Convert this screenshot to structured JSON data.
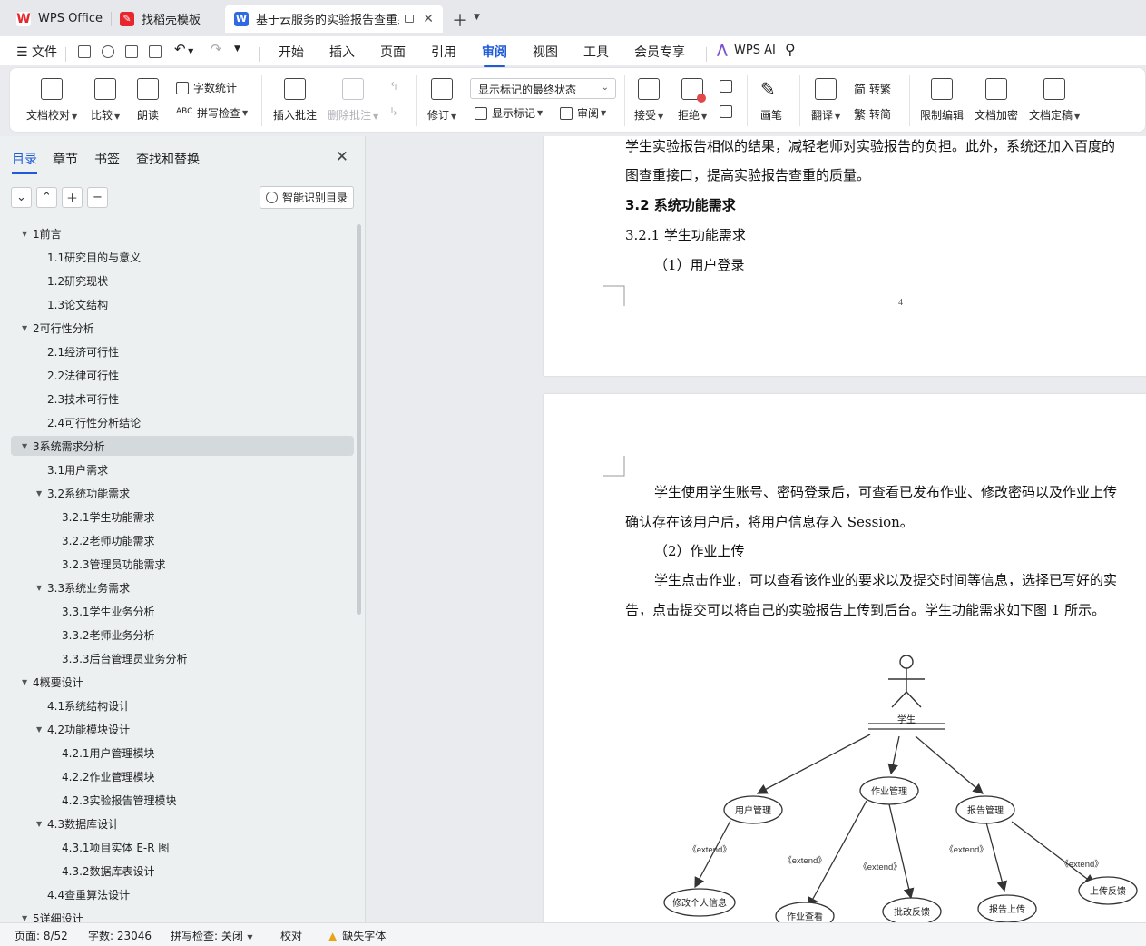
{
  "tabs": [
    {
      "label": "WPS Office",
      "icon": "wps-logo-icon"
    },
    {
      "label": "找稻壳模板",
      "icon": "docer-icon"
    },
    {
      "label": "基于云服务的实验报告查重系统",
      "icon": "writer-icon",
      "active": true
    }
  ],
  "menu": {
    "file": "文件",
    "items": [
      "开始",
      "插入",
      "页面",
      "引用",
      "审阅",
      "视图",
      "工具",
      "会员专享"
    ],
    "active": "审阅",
    "ai": "WPS AI"
  },
  "ribbon": {
    "doc_proof": "文档校对",
    "compare": "比较",
    "read_aloud": "朗读",
    "word_count": "字数统计",
    "spell_check": "拼写检查",
    "insert_comment": "插入批注",
    "delete_comment": "删除批注",
    "track_changes": "修订",
    "markup_state": "显示标记的最终状态",
    "show_markup": "显示标记",
    "review": "审阅",
    "accept": "接受",
    "reject": "拒绝",
    "pen": "画笔",
    "translate": "翻译",
    "to_traditional": "转繁",
    "to_simplified": "转简",
    "restrict_edit": "限制编辑",
    "encrypt": "文档加密",
    "finalize": "文档定稿"
  },
  "panel": {
    "tabs": [
      "目录",
      "章节",
      "书签",
      "查找和替换"
    ],
    "active_tab": "目录",
    "smart_toc": "智能识别目录",
    "toc": [
      {
        "text": "1前言",
        "level": 1,
        "expanded": true
      },
      {
        "text": "1.1研究目的与意义",
        "level": 2
      },
      {
        "text": "1.2研究现状",
        "level": 2
      },
      {
        "text": "1.3论文结构",
        "level": 2
      },
      {
        "text": "2可行性分析",
        "level": 1,
        "expanded": true
      },
      {
        "text": "2.1经济可行性",
        "level": 2
      },
      {
        "text": "2.2法律可行性",
        "level": 2
      },
      {
        "text": "2.3技术可行性",
        "level": 2
      },
      {
        "text": "2.4可行性分析结论",
        "level": 2
      },
      {
        "text": "3系统需求分析",
        "level": 1,
        "expanded": true,
        "selected": true
      },
      {
        "text": "3.1用户需求",
        "level": 2
      },
      {
        "text": "3.2系统功能需求",
        "level": 2,
        "expanded": true
      },
      {
        "text": "3.2.1学生功能需求",
        "level": 3
      },
      {
        "text": "3.2.2老师功能需求",
        "level": 3
      },
      {
        "text": "3.2.3管理员功能需求",
        "level": 3
      },
      {
        "text": "3.3系统业务需求",
        "level": 2,
        "expanded": true
      },
      {
        "text": "3.3.1学生业务分析",
        "level": 3
      },
      {
        "text": "3.3.2老师业务分析",
        "level": 3
      },
      {
        "text": "3.3.3后台管理员业务分析",
        "level": 3
      },
      {
        "text": "4概要设计",
        "level": 1,
        "expanded": true
      },
      {
        "text": "4.1系统结构设计",
        "level": 2
      },
      {
        "text": "4.2功能模块设计",
        "level": 2,
        "expanded": true
      },
      {
        "text": "4.2.1用户管理模块",
        "level": 3
      },
      {
        "text": "4.2.2作业管理模块",
        "level": 3
      },
      {
        "text": "4.2.3实验报告管理模块",
        "level": 3
      },
      {
        "text": "4.3数据库设计",
        "level": 2,
        "expanded": true
      },
      {
        "text": "4.3.1项目实体 E-R 图",
        "level": 3
      },
      {
        "text": "4.3.2数据库表设计",
        "level": 3
      },
      {
        "text": "4.4查重算法设计",
        "level": 2
      },
      {
        "text": "5详细设计",
        "level": 1,
        "expanded": true
      }
    ]
  },
  "document": {
    "page1": {
      "line1": "学生实验报告相似的结果，减轻老师对实验报告的负担。此外，系统还加入百度的",
      "line2": "图查重接口，提高实验报告查重的质量。",
      "h_32": "3.2 系统功能需求",
      "h_321": "3.2.1  学生功能需求",
      "item1": "（1）用户登录",
      "page_number": "4"
    },
    "page2": {
      "p1a": "学生使用学生账号、密码登录后，可查看已发布作业、修改密码以及作业上传",
      "p1b": "确认存在该用户后，将用户信息存入 Session。",
      "item2": "（2）作业上传",
      "p2a": "学生点击作业，可以查看该作业的要求以及提交时间等信息，选择已写好的实",
      "p2b": "告，点击提交可以将自己的实验报告上传到后台。学生功能需求如下图 1 所示。"
    },
    "diagram": {
      "actor": "学生",
      "nodes": [
        "用户管理",
        "作业管理",
        "报告管理",
        "修改个人信息",
        "作业查看",
        "批改反馈",
        "报告上传",
        "上传反馈"
      ],
      "edge_label": "《extend》"
    }
  },
  "status": {
    "page": "页面: 8/52",
    "words": "字数: 23046",
    "spell": "拼写检查: 关闭",
    "proof": "校对",
    "missing_font": "缺失字体"
  },
  "colors": {
    "accent": "#1f5bd8",
    "wps_red": "#e8262d",
    "selected_row": "#d4d9dc"
  }
}
